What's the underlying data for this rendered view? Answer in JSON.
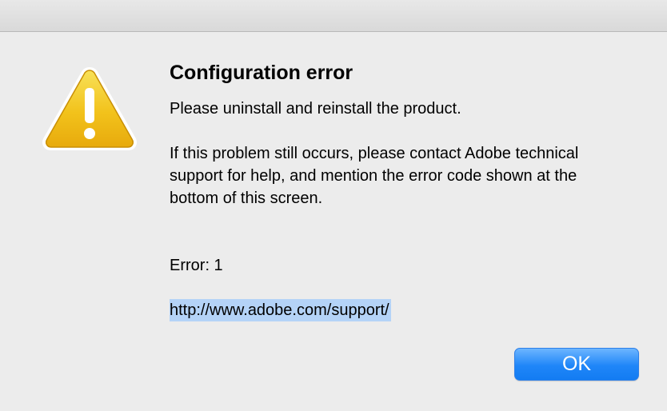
{
  "dialog": {
    "title": "Configuration error",
    "instruction": "Please uninstall and reinstall the product.",
    "details": "If this problem still occurs, please contact Adobe technical support for help, and mention the error code shown at the bottom of this screen.",
    "error_code": "Error: 1",
    "support_url": "http://www.adobe.com/support/",
    "ok_label": "OK",
    "icon": "warning-icon",
    "colors": {
      "background": "#ececec",
      "warning_yellow": "#f2c21b",
      "button_blue": "#1f86f8",
      "selection_highlight": "#b4d3f7"
    }
  }
}
